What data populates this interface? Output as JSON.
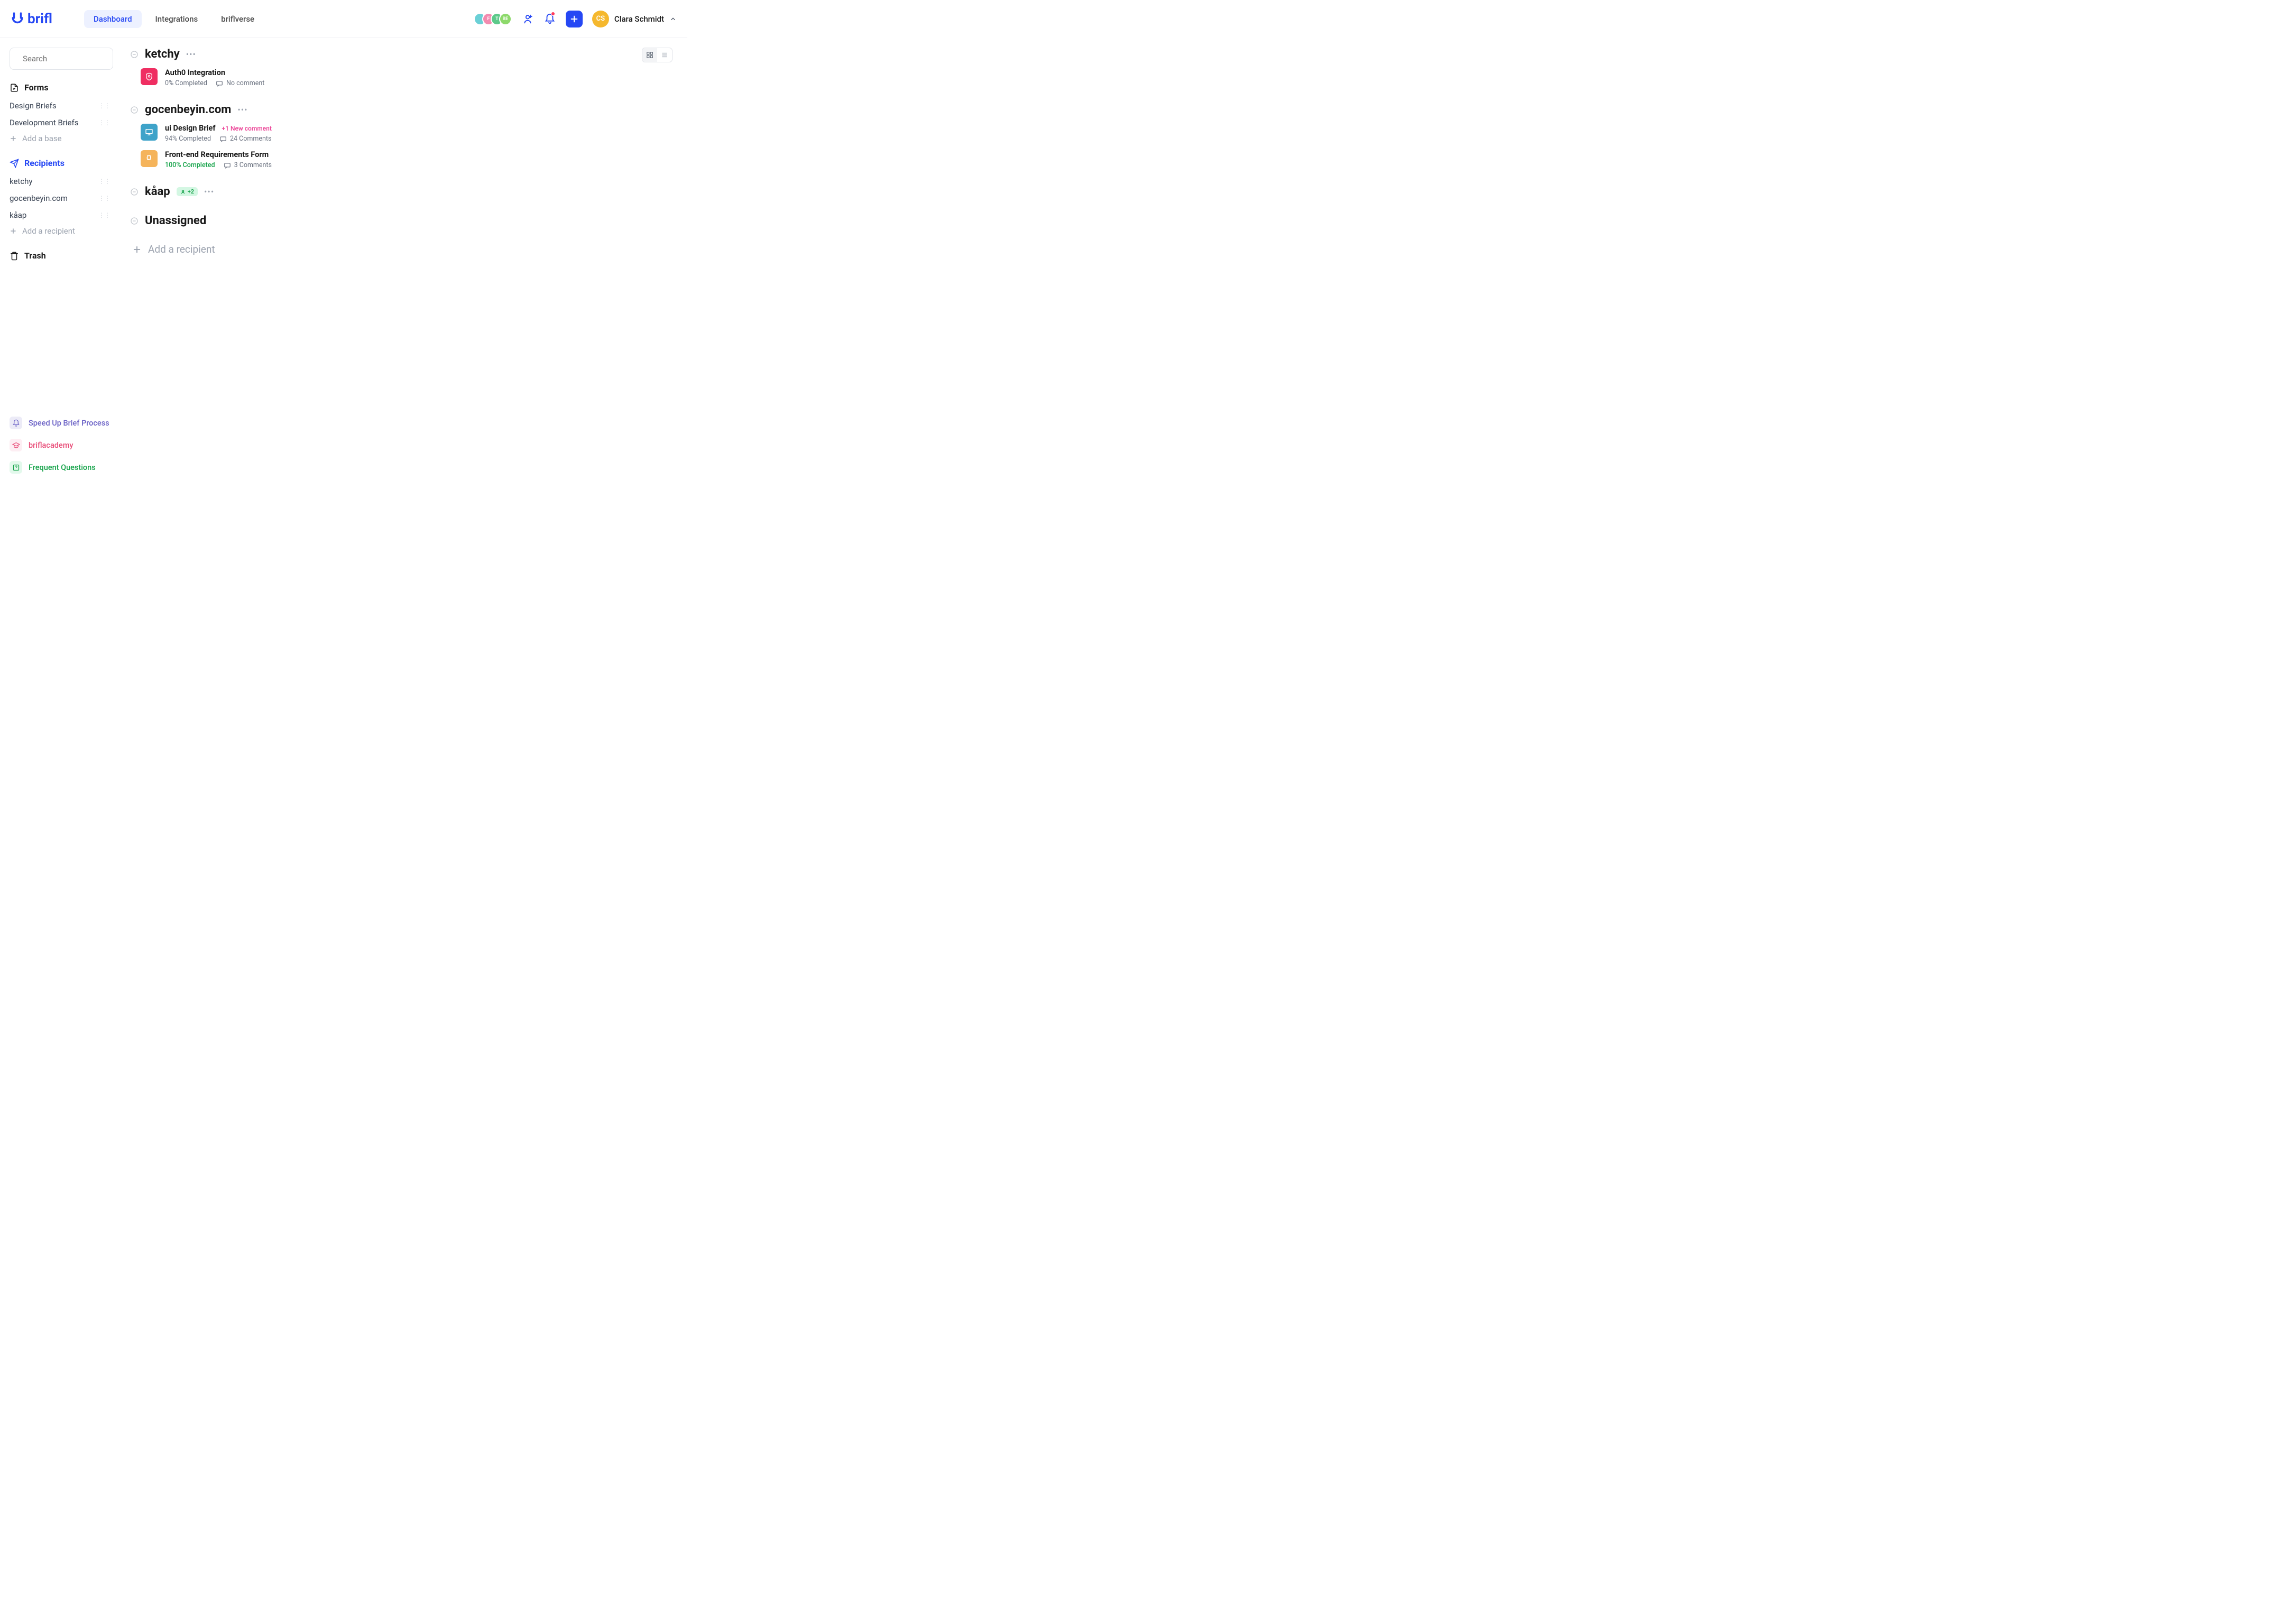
{
  "brand": "brifl",
  "nav": {
    "dashboard": "Dashboard",
    "integrations": "Integrations",
    "briflverse": "briflverse"
  },
  "user": {
    "initials": "CS",
    "name": "Clara Schmidt"
  },
  "sidebar": {
    "search_placeholder": "Search",
    "forms_title": "Forms",
    "forms": [
      {
        "label": "Design Briefs"
      },
      {
        "label": "Development Briefs"
      }
    ],
    "add_base": "Add a base",
    "recipients_title": "Recipients",
    "recipients": [
      {
        "label": "ketchy"
      },
      {
        "label": "gocenbeyin.com"
      },
      {
        "label": "kåap"
      }
    ],
    "add_recipient": "Add a recipient",
    "trash": "Trash",
    "footer": {
      "speed_up": "Speed Up Brief Process",
      "academy": "briflacademy",
      "faq": "Frequent Questions"
    }
  },
  "main": {
    "groups": [
      {
        "title": "ketchy",
        "badge": null,
        "cards": [
          {
            "icon_bg": "#ef2e62",
            "icon": "shield",
            "title": "Auth0 Integration",
            "completion": "0% Completed",
            "completion_full": false,
            "comments": "No comment",
            "new_comment": null
          }
        ]
      },
      {
        "title": "gocenbeyin.com",
        "badge": null,
        "cards": [
          {
            "icon_bg": "#3ea3c9",
            "icon": "monitor",
            "title": "ui Design Brief",
            "completion": "94% Completed",
            "completion_full": false,
            "comments": "24 Comments",
            "new_comment": "+1 New comment"
          },
          {
            "icon_bg": "#f5b45b",
            "icon": "puzzle",
            "title": "Front-end Requirements Form",
            "completion": "100% Completed",
            "completion_full": true,
            "comments": "3 Comments",
            "new_comment": null
          }
        ]
      },
      {
        "title": "kåap",
        "badge": "+2",
        "cards": []
      },
      {
        "title": "Unassigned",
        "badge": null,
        "cards": []
      }
    ],
    "add_recipient": "Add a recipient"
  }
}
